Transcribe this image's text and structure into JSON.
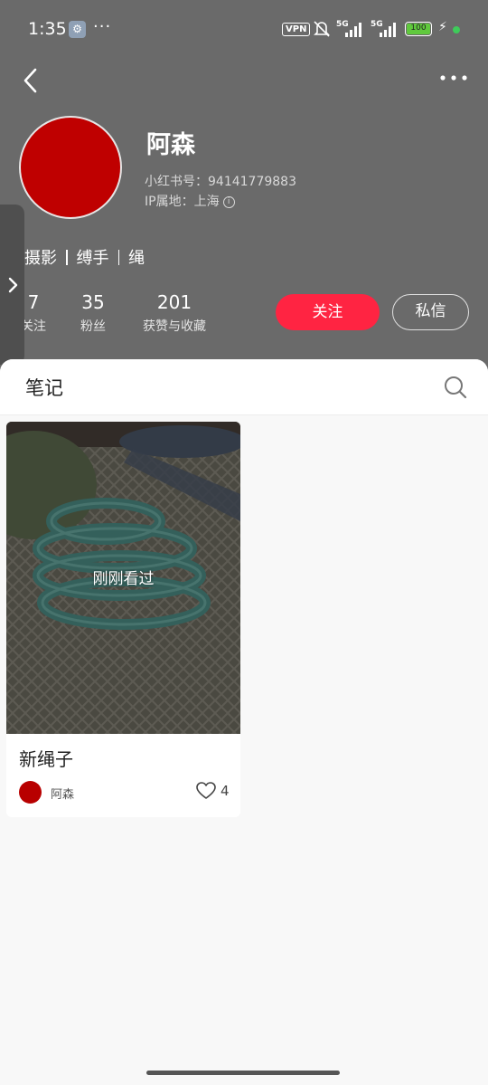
{
  "status_bar": {
    "time": "1:35",
    "more": "···",
    "vpn": "VPN",
    "network_1": "5G",
    "network_2": "5G",
    "battery": "100"
  },
  "profile": {
    "name": "阿森",
    "id_text": "小红书号：94141779883",
    "ip_text": "IP属地：上海",
    "tags": [
      "摄影",
      "缚手",
      "绳"
    ],
    "stats": [
      {
        "value": "7",
        "label": "关注"
      },
      {
        "value": "35",
        "label": "粉丝"
      },
      {
        "value": "201",
        "label": "获赞与收藏"
      }
    ],
    "follow_label": "关注",
    "message_label": "私信"
  },
  "notes_section": {
    "title": "笔记"
  },
  "notes": [
    {
      "overlay": "刚刚看过",
      "title": "新绳子",
      "author": "阿森",
      "likes": "4"
    }
  ],
  "colors": {
    "header_bg": "#6a6a6a",
    "accent": "#ff2442",
    "avatar": "#bf0000"
  },
  "icons": [
    "back-icon",
    "more-icon",
    "info-icon",
    "chevron-right-icon",
    "search-icon",
    "heart-icon"
  ]
}
